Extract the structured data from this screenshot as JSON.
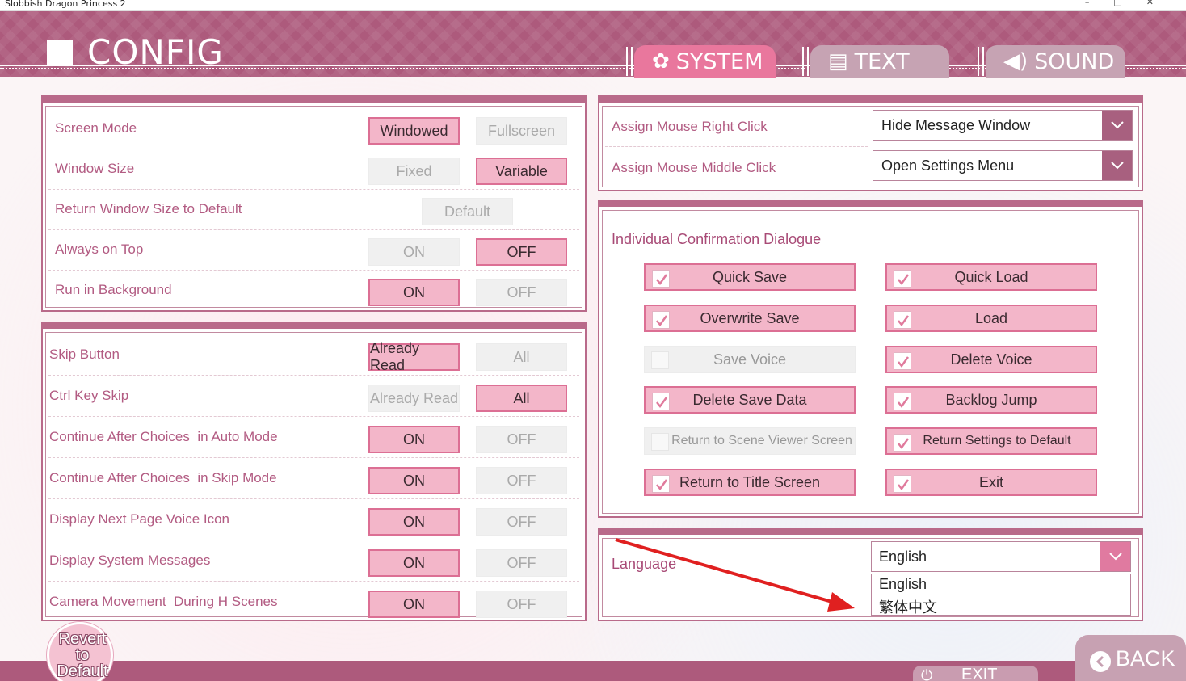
{
  "window": {
    "title": "Slobbish Dragon Princess 2",
    "controls": [
      "–",
      "□",
      "✕"
    ]
  },
  "header": {
    "title": "CONFIG",
    "tabs": [
      {
        "label": "SYSTEM",
        "icon": "gear-icon",
        "active": true
      },
      {
        "label": "TEXT",
        "icon": "document-icon",
        "active": false
      },
      {
        "label": "SOUND",
        "icon": "speaker-icon",
        "active": false
      }
    ]
  },
  "display_panel": {
    "rows": [
      {
        "label": "Screen Mode",
        "a": "Windowed",
        "b": "Fullscreen",
        "selected": "a"
      },
      {
        "label": "Window Size",
        "a": "Fixed",
        "b": "Variable",
        "selected": "b"
      },
      {
        "label": "Return Window Size to Default",
        "button": "Default"
      },
      {
        "label": "Always on Top",
        "a": "ON",
        "b": "OFF",
        "selected": "b"
      },
      {
        "label": "Run in Background",
        "a": "ON",
        "b": "OFF",
        "selected": "a"
      }
    ]
  },
  "skip_panel": {
    "rows": [
      {
        "label": "Skip Button",
        "a": "Already Read",
        "b": "All",
        "selected": "a"
      },
      {
        "label": "Ctrl Key Skip",
        "a": "Already Read",
        "b": "All",
        "selected": "b"
      },
      {
        "label": "Continue After Choices  in Auto Mode",
        "a": "ON",
        "b": "OFF",
        "selected": "a"
      },
      {
        "label": "Continue After Choices  in Skip Mode",
        "a": "ON",
        "b": "OFF",
        "selected": "a"
      },
      {
        "label": "Display Next Page Voice Icon",
        "a": "ON",
        "b": "OFF",
        "selected": "a"
      },
      {
        "label": "Display System Messages",
        "a": "ON",
        "b": "OFF",
        "selected": "a"
      },
      {
        "label": "Camera Movement  During H Scenes",
        "a": "ON",
        "b": "OFF",
        "selected": "a"
      }
    ]
  },
  "mouse_panel": {
    "right_click": {
      "label": "Assign Mouse Right Click",
      "value": "Hide Message Window"
    },
    "middle_click": {
      "label": "Assign Mouse Middle Click",
      "value": "Open Settings Menu"
    }
  },
  "confirm_panel": {
    "title": "Individual Confirmation Dialogue",
    "items": [
      {
        "label": "Quick Save",
        "checked": true
      },
      {
        "label": "Quick Load",
        "checked": true
      },
      {
        "label": "Overwrite Save",
        "checked": true
      },
      {
        "label": "Load",
        "checked": true
      },
      {
        "label": "Save Voice",
        "checked": false
      },
      {
        "label": "Delete Voice",
        "checked": true
      },
      {
        "label": "Delete Save Data",
        "checked": true
      },
      {
        "label": "Backlog Jump",
        "checked": true
      },
      {
        "label": "Return to Scene Viewer Screen",
        "checked": false
      },
      {
        "label": "Return Settings to Default",
        "checked": true
      },
      {
        "label": "Return to Title Screen",
        "checked": true
      },
      {
        "label": "Exit",
        "checked": true
      }
    ]
  },
  "language_panel": {
    "label": "Language",
    "value": "English",
    "options": [
      "English",
      "繁体中文"
    ]
  },
  "footer": {
    "revert": [
      "Revert",
      "to",
      "Default"
    ],
    "exit": "EXIT",
    "back": "BACK"
  },
  "colors": {
    "accent": "#ad5a7c",
    "selected_fill": "#f3b6c9",
    "selected_border": "#dc6f94",
    "label_text": "#b25b82",
    "annotation_arrow": "#e02020"
  }
}
